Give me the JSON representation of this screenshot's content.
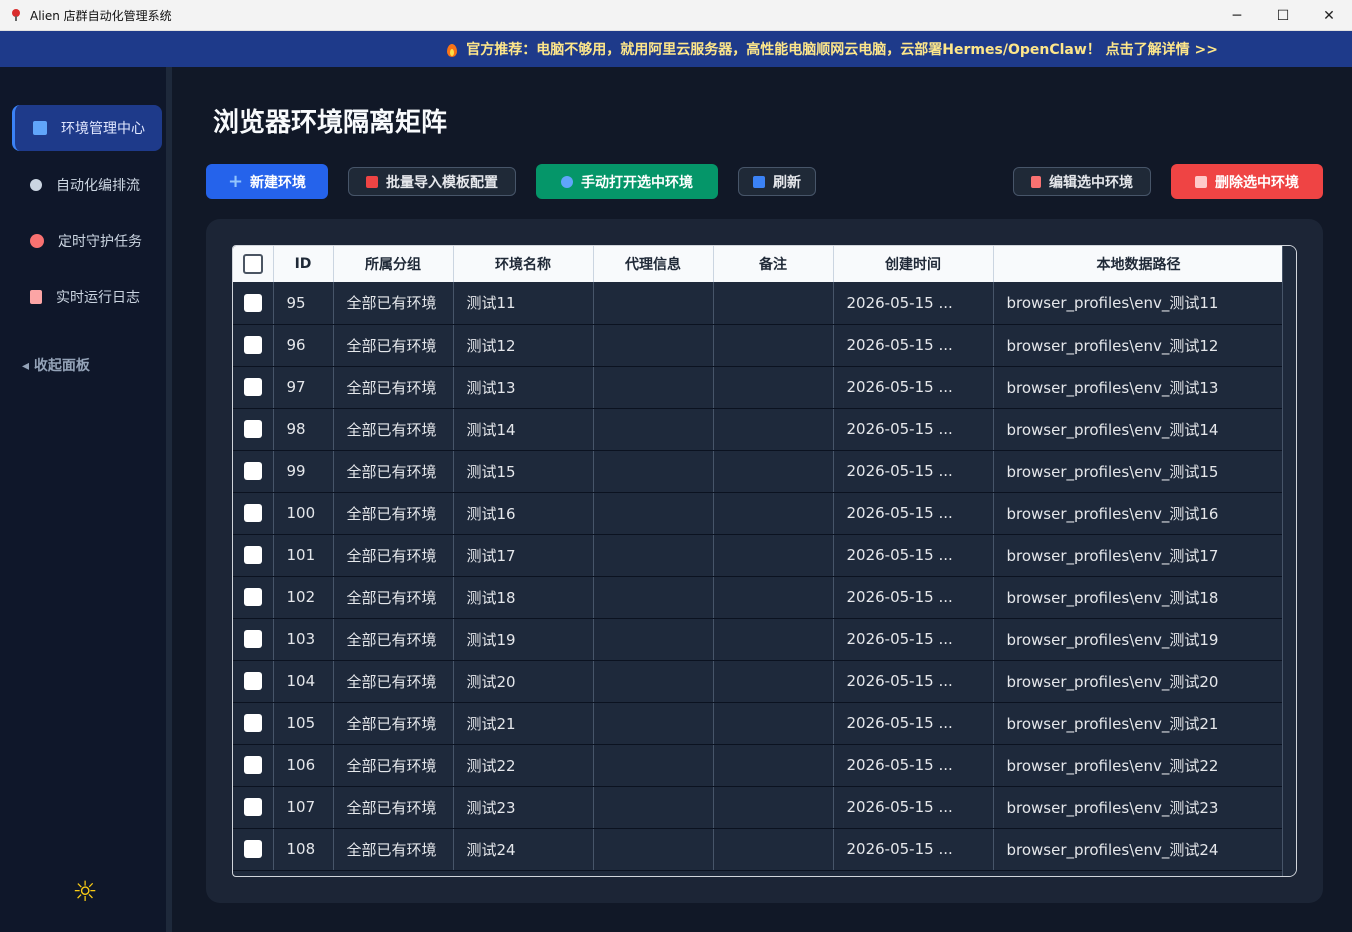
{
  "window": {
    "title": "Alien 店群自动化管理系统",
    "controls": [
      "─",
      "☐",
      "✕"
    ]
  },
  "banner": {
    "text": "官方推荐：电脑不够用，就用阿里云服务器，高性能电脑顺网云电脑，云部署Hermes/OpenClaw！ 点击了解详情 >>"
  },
  "sidebar": {
    "items": [
      {
        "label": "环境管理中心",
        "icon": "laptop-icon",
        "active": true
      },
      {
        "label": "自动化编排流",
        "icon": "gear-icon",
        "active": false
      },
      {
        "label": "定时守护任务",
        "icon": "alarm-clock-icon",
        "active": false
      },
      {
        "label": "实时运行日志",
        "icon": "log-document-icon",
        "active": false
      }
    ],
    "collapse_label": "◂ 收起面板",
    "theme_icon": "sun-icon"
  },
  "main": {
    "title": "浏览器环境隔离矩阵",
    "toolbar": {
      "new_env": "新建环境",
      "batch_import": "批量导入模板配置",
      "open_selected": "手动打开选中环境",
      "refresh": "刷新",
      "edit_selected": "编辑选中环境",
      "delete_selected": "删除选中环境"
    },
    "table": {
      "columns": [
        "",
        "ID",
        "所属分组",
        "环境名称",
        "代理信息",
        "备注",
        "创建时间",
        "本地数据路径"
      ],
      "rows": [
        {
          "id": "95",
          "group": "全部已有环境",
          "name": "测试11",
          "proxy": "",
          "note": "",
          "created": "2026-05-15 ...",
          "path": "browser_profiles\\env_测试11"
        },
        {
          "id": "96",
          "group": "全部已有环境",
          "name": "测试12",
          "proxy": "",
          "note": "",
          "created": "2026-05-15 ...",
          "path": "browser_profiles\\env_测试12"
        },
        {
          "id": "97",
          "group": "全部已有环境",
          "name": "测试13",
          "proxy": "",
          "note": "",
          "created": "2026-05-15 ...",
          "path": "browser_profiles\\env_测试13"
        },
        {
          "id": "98",
          "group": "全部已有环境",
          "name": "测试14",
          "proxy": "",
          "note": "",
          "created": "2026-05-15 ...",
          "path": "browser_profiles\\env_测试14"
        },
        {
          "id": "99",
          "group": "全部已有环境",
          "name": "测试15",
          "proxy": "",
          "note": "",
          "created": "2026-05-15 ...",
          "path": "browser_profiles\\env_测试15"
        },
        {
          "id": "100",
          "group": "全部已有环境",
          "name": "测试16",
          "proxy": "",
          "note": "",
          "created": "2026-05-15 ...",
          "path": "browser_profiles\\env_测试16"
        },
        {
          "id": "101",
          "group": "全部已有环境",
          "name": "测试17",
          "proxy": "",
          "note": "",
          "created": "2026-05-15 ...",
          "path": "browser_profiles\\env_测试17"
        },
        {
          "id": "102",
          "group": "全部已有环境",
          "name": "测试18",
          "proxy": "",
          "note": "",
          "created": "2026-05-15 ...",
          "path": "browser_profiles\\env_测试18"
        },
        {
          "id": "103",
          "group": "全部已有环境",
          "name": "测试19",
          "proxy": "",
          "note": "",
          "created": "2026-05-15 ...",
          "path": "browser_profiles\\env_测试19"
        },
        {
          "id": "104",
          "group": "全部已有环境",
          "name": "测试20",
          "proxy": "",
          "note": "",
          "created": "2026-05-15 ...",
          "path": "browser_profiles\\env_测试20"
        },
        {
          "id": "105",
          "group": "全部已有环境",
          "name": "测试21",
          "proxy": "",
          "note": "",
          "created": "2026-05-15 ...",
          "path": "browser_profiles\\env_测试21"
        },
        {
          "id": "106",
          "group": "全部已有环境",
          "name": "测试22",
          "proxy": "",
          "note": "",
          "created": "2026-05-15 ...",
          "path": "browser_profiles\\env_测试22"
        },
        {
          "id": "107",
          "group": "全部已有环境",
          "name": "测试23",
          "proxy": "",
          "note": "",
          "created": "2026-05-15 ...",
          "path": "browser_profiles\\env_测试23"
        },
        {
          "id": "108",
          "group": "全部已有环境",
          "name": "测试24",
          "proxy": "",
          "note": "",
          "created": "2026-05-15 ...",
          "path": "browser_profiles\\env_测试24"
        }
      ]
    }
  },
  "colors": {
    "primary": "#2563eb",
    "success": "#059669",
    "danger": "#ef4444",
    "banner_bg": "#1e3a8a",
    "app_bg": "#111827"
  }
}
